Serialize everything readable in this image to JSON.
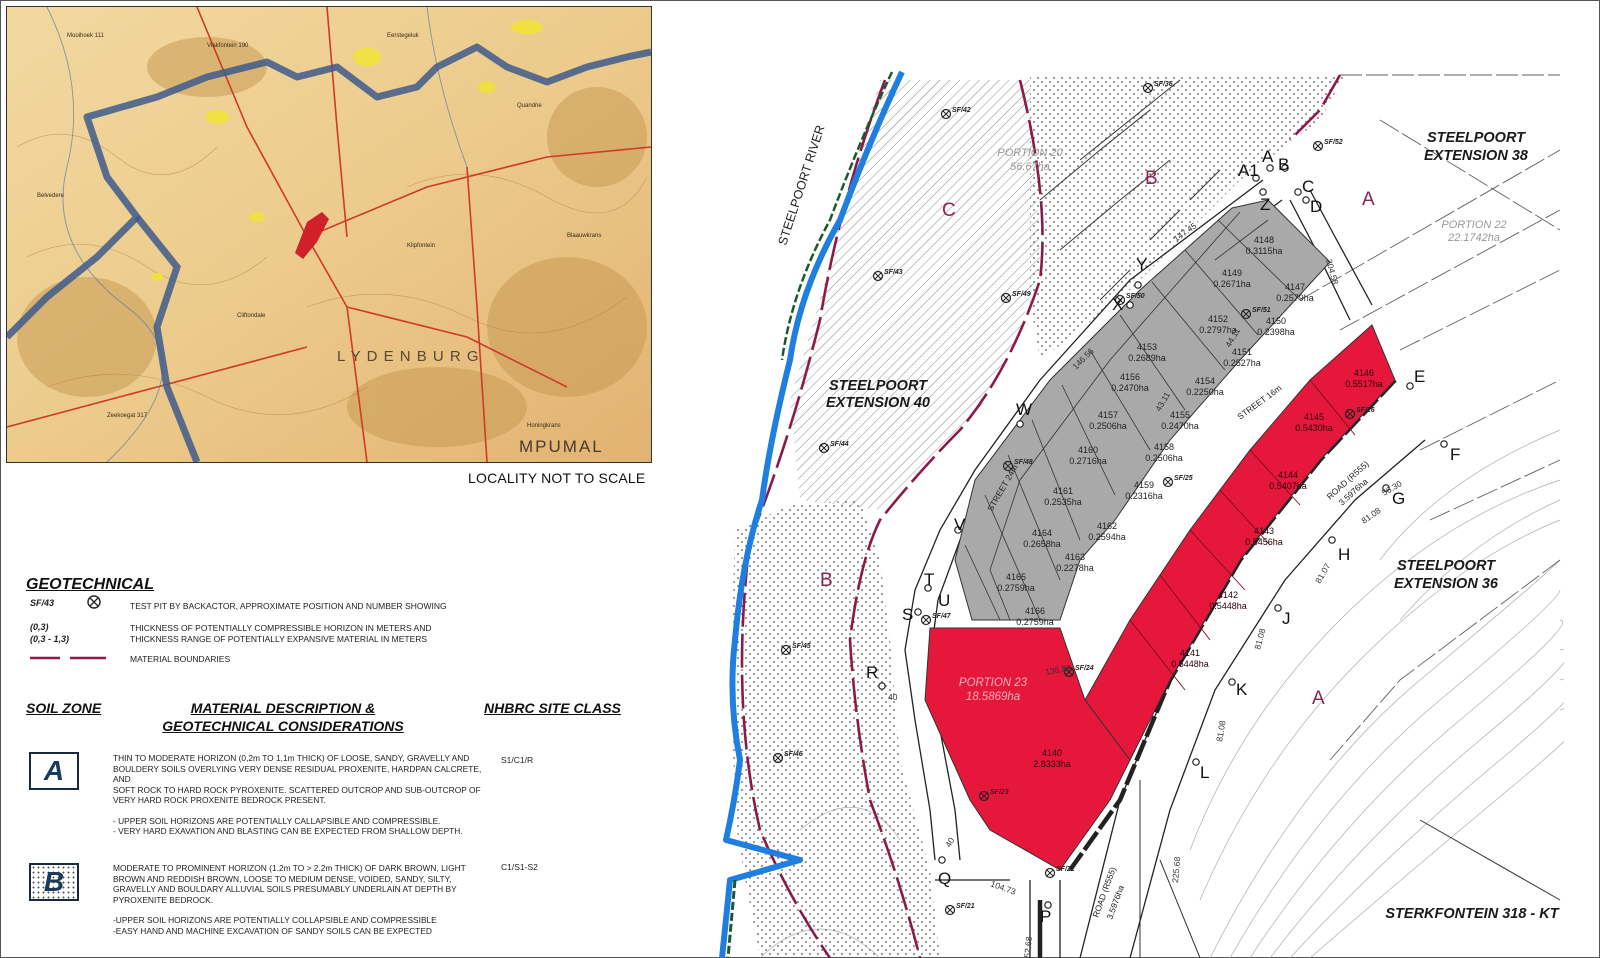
{
  "locality": {
    "caption": "LOCALITY NOT TO SCALE",
    "labels": {
      "town": "L Y D E N B U R G",
      "province": "MPUMAL"
    }
  },
  "legend": {
    "title": "GEOTECHNICAL",
    "test_pit_code": "SF/43",
    "test_pit_desc": "TEST PIT BY BACKACTOR, APPROXIMATE POSITION AND NUMBER SHOWING",
    "thickness_code_1": "(0,3)",
    "thickness_code_2": "(0,3 - 1,3)",
    "thickness_desc_1": "THICKNESS OF POTENTIALLY COMPRESSIBLE HORIZON IN METERS AND",
    "thickness_desc_2": "THICKNESS RANGE OF POTENTIALLY EXPANSIVE MATERIAL IN METERS",
    "boundary_desc": "MATERIAL BOUNDARIES"
  },
  "soil_table": {
    "col_zone": "SOIL ZONE",
    "col_desc_1": "MATERIAL DESCRIPTION &",
    "col_desc_2": "GEOTECHNICAL CONSIDERATIONS",
    "col_class": "NHBRC SITE CLASS",
    "zones": [
      {
        "letter": "A",
        "lines": [
          "THIN TO MODERATE HORIZON (0,2m TO 1,1m THICK) OF LOOSE, SANDY, GRAVELLY AND",
          "BOULDERY SOILS OVERLYING VERY DENSE RESIDUAL PROXENITE, HARDPAN CALCRETE, AND",
          "SOFT ROCK TO HARD ROCK PYROXENITE. SCATTERED OUTCROP AND SUB-OUTCROP OF",
          "VERY HARD ROCK PROXENITE BEDROCK PRESENT.",
          "",
          "- UPPER SOIL HORIZONS ARE POTENTIALLY CALLAPSIBLE AND COMPRESSIBLE.",
          "- VERY HARD EXAVATION AND BLASTING CAN BE EXPECTED FROM SHALLOW DEPTH."
        ],
        "site_class": "S1/C1/R"
      },
      {
        "letter": "B",
        "lines": [
          "MODERATE TO PROMINENT HORIZON (1.2m TO > 2.2m THICK) OF DARK BROWN, LIGHT",
          "BROWN AND REDDISH BROWN, LOOSE TO MEDIUM DENSE, VOIDED, SANDY, SILTY,",
          "GRAVELLY AND BOULDARY ALLUVIAL SOILS PRESUMABLY UNDERLAIN AT DEPTH BY",
          "PYROXENITE BEDROCK.",
          "",
          "-UPPER SOIL HORIZONS ARE POTENTIALLY COLLAPSIBLE AND COMPRESSIBLE",
          "-EASY HAND AND MACHINE EXCAVATION OF SANDY SOILS CAN BE EXPECTED"
        ],
        "site_class": "C1/S1-S2"
      }
    ]
  },
  "site_plan": {
    "river": "STEELPOORT RIVER",
    "ext40_1": "STEELPOORT",
    "ext40_2": "EXTENSION 40",
    "ext38_1": "STEELPOORT",
    "ext38_2": "EXTENSION 38",
    "ext36_1": "STEELPOORT",
    "ext36_2": "EXTENSION 36",
    "farm": "STERKFONTEIN 318 - KT",
    "portion22_1": "PORTION 22",
    "portion22_2": "22.1742ha",
    "portion20_1": "PORTION 20",
    "portion20_2": "56.67ha",
    "portion23_1": "PORTION 23",
    "portion23_2": "18.5869ha",
    "street24": "STREET 24m",
    "street16": "STREET 16m",
    "road_a_1": "ROAD (R555)",
    "road_a_2": "3.5976ha",
    "road_b_1": "ROAD (R555)",
    "road_b_2": "3.5976ha",
    "colors": {
      "red": "#e5183c",
      "grey": "#a9a9a9",
      "river": "#1e7fe0",
      "boundary": "#8b1a4a",
      "zone_label": "#8b2252"
    },
    "zones": [
      {
        "letter": "A"
      },
      {
        "letter": "A"
      },
      {
        "letter": "B"
      },
      {
        "letter": "B"
      },
      {
        "letter": "C"
      }
    ],
    "stands_grey": [
      {
        "id": "4148",
        "area": "0.3115ha"
      },
      {
        "id": "4149",
        "area": "0.2671ha"
      },
      {
        "id": "4147",
        "area": "0.2579ha"
      },
      {
        "id": "4152",
        "area": "0.2797ha"
      },
      {
        "id": "4150",
        "area": "0.2398ha"
      },
      {
        "id": "4153",
        "area": "0.2689ha"
      },
      {
        "id": "4151",
        "area": "0.2527ha"
      },
      {
        "id": "4156",
        "area": "0.2470ha"
      },
      {
        "id": "4154",
        "area": "0.2250ha"
      },
      {
        "id": "4157",
        "area": "0.2506ha"
      },
      {
        "id": "4155",
        "area": "0.2470ha"
      },
      {
        "id": "4160",
        "area": "0.2716ha"
      },
      {
        "id": "4158",
        "area": "0.2506ha"
      },
      {
        "id": "4161",
        "area": "0.2535ha"
      },
      {
        "id": "4159",
        "area": "0.2316ha"
      },
      {
        "id": "4164",
        "area": "0.2658ha"
      },
      {
        "id": "4162",
        "area": "0.2594ha"
      },
      {
        "id": "4165",
        "area": "0.2759ha"
      },
      {
        "id": "4163",
        "area": "0.2278ha"
      },
      {
        "id": "4166",
        "area": "0.2759ha"
      }
    ],
    "stands_red": [
      {
        "id": "4146",
        "area": "0.5517ha"
      },
      {
        "id": "4145",
        "area": "0.5430ha"
      },
      {
        "id": "4144",
        "area": "0.5407ha"
      },
      {
        "id": "4143",
        "area": "0.5456ha"
      },
      {
        "id": "4142",
        "area": "0.5448ha"
      },
      {
        "id": "4141",
        "area": "0.5448ha"
      },
      {
        "id": "4140",
        "area": "2.8333ha"
      }
    ],
    "points": [
      "A1",
      "A",
      "B",
      "C",
      "D",
      "Z",
      "Y",
      "X",
      "W",
      "V",
      "T",
      "U",
      "S",
      "R",
      "Q",
      "P",
      "E",
      "F",
      "G",
      "H",
      "J",
      "K",
      "L"
    ],
    "pits": [
      "SF/36",
      "SF/42",
      "SF/52",
      "SF/43",
      "SF/49",
      "SF/50",
      "SF/51",
      "SF/44",
      "SF/48",
      "SF/25",
      "SF/26",
      "SF/47",
      "SF/45",
      "SF/24",
      "SF/46",
      "SF/23",
      "SF/22",
      "SF/21"
    ],
    "dims": [
      "147.45",
      "204.58",
      "146.56",
      "44.11",
      "43.11",
      "56.30",
      "81.08",
      "81.07",
      "81.08",
      "81.08",
      "225.68",
      "136.83",
      "40",
      "40",
      "104.73",
      "52.68"
    ]
  }
}
